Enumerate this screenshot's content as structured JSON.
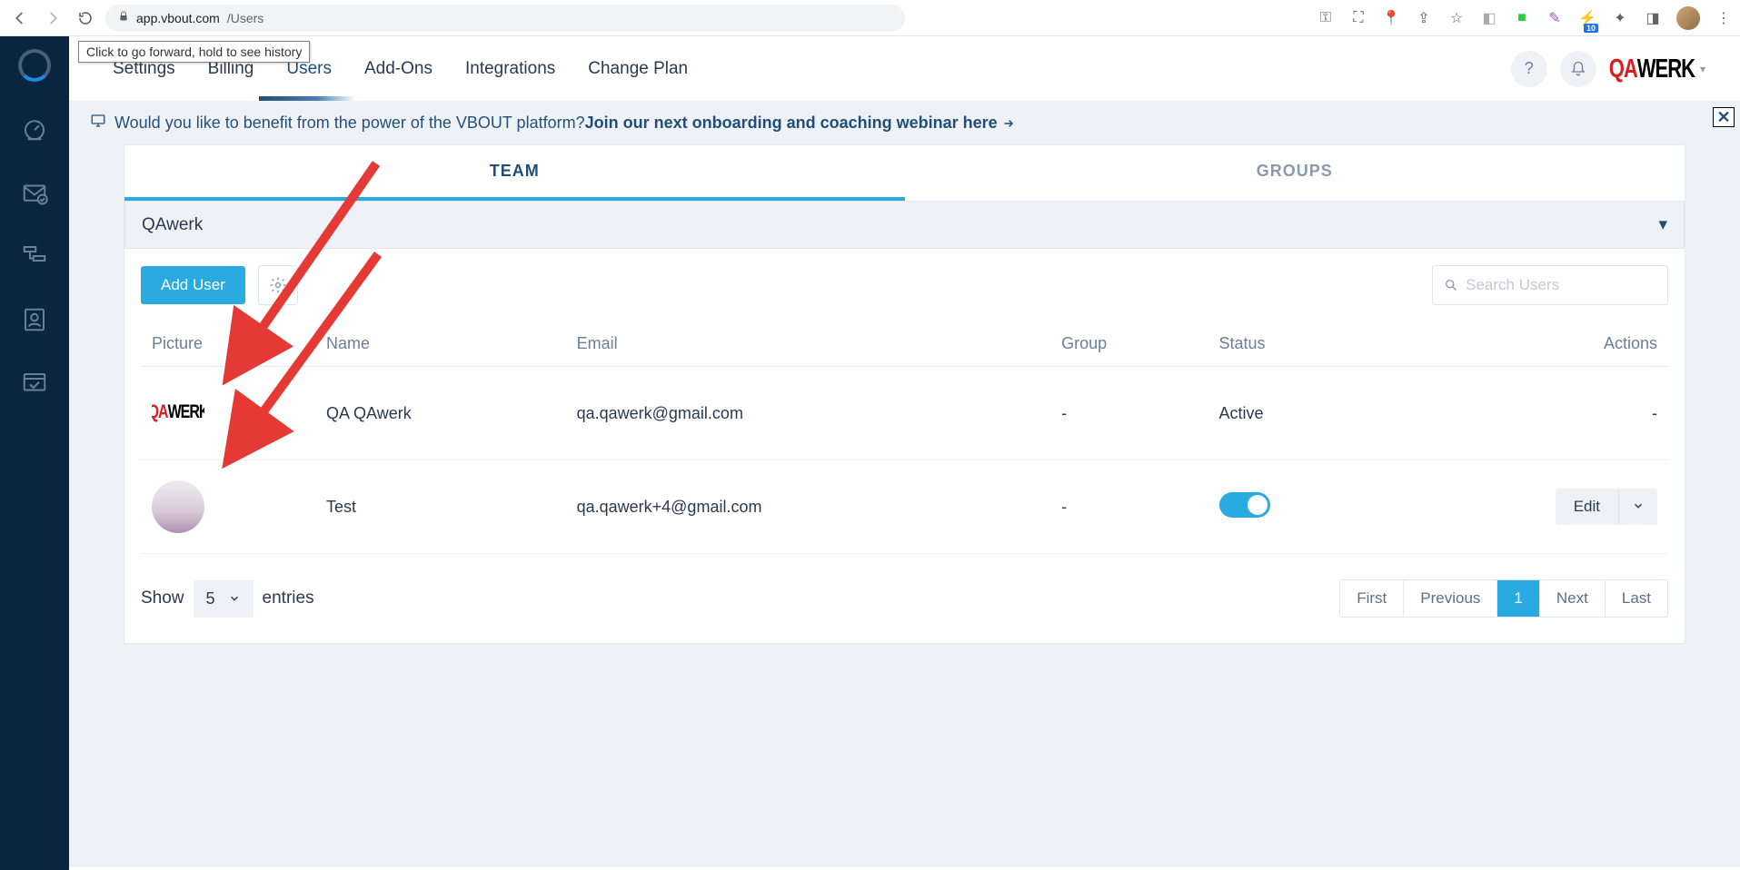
{
  "browser": {
    "url_host": "app.vbout.com",
    "url_path": "/Users",
    "forward_tooltip": "Click to go forward, hold to see history",
    "ext_badge": "10"
  },
  "topnav": {
    "items": [
      "Settings",
      "Billing",
      "Users",
      "Add-Ons",
      "Integrations",
      "Change Plan"
    ],
    "active_index": 2
  },
  "brand": {
    "q": "QA",
    "rest": "WERK"
  },
  "banner": {
    "lead": "Would you like to benefit from the power of the VBOUT platform? ",
    "link": "Join our next onboarding and coaching webinar here"
  },
  "subtabs": {
    "items": [
      "TEAM",
      "GROUPS"
    ],
    "active_index": 0
  },
  "account_dropdown": "QAwerk",
  "toolbar": {
    "add_user": "Add User",
    "search_placeholder": "Search Users"
  },
  "table": {
    "headers": [
      "Picture",
      "Name",
      "Email",
      "Group",
      "Status",
      "Actions"
    ],
    "rows": [
      {
        "name": "QA QAwerk",
        "email": "qa.qawerk@gmail.com",
        "group": "-",
        "status": "Active",
        "actions": "-",
        "pic_type": "logo"
      },
      {
        "name": "Test",
        "email": "qa.qawerk+4@gmail.com",
        "group": "-",
        "status": "toggle",
        "actions": "edit",
        "pic_type": "photo"
      }
    ],
    "edit_label": "Edit"
  },
  "footer": {
    "show": "Show",
    "entries": "entries",
    "page_size": "5",
    "pager": [
      "First",
      "Previous",
      "1",
      "Next",
      "Last"
    ],
    "pager_active_index": 2
  }
}
